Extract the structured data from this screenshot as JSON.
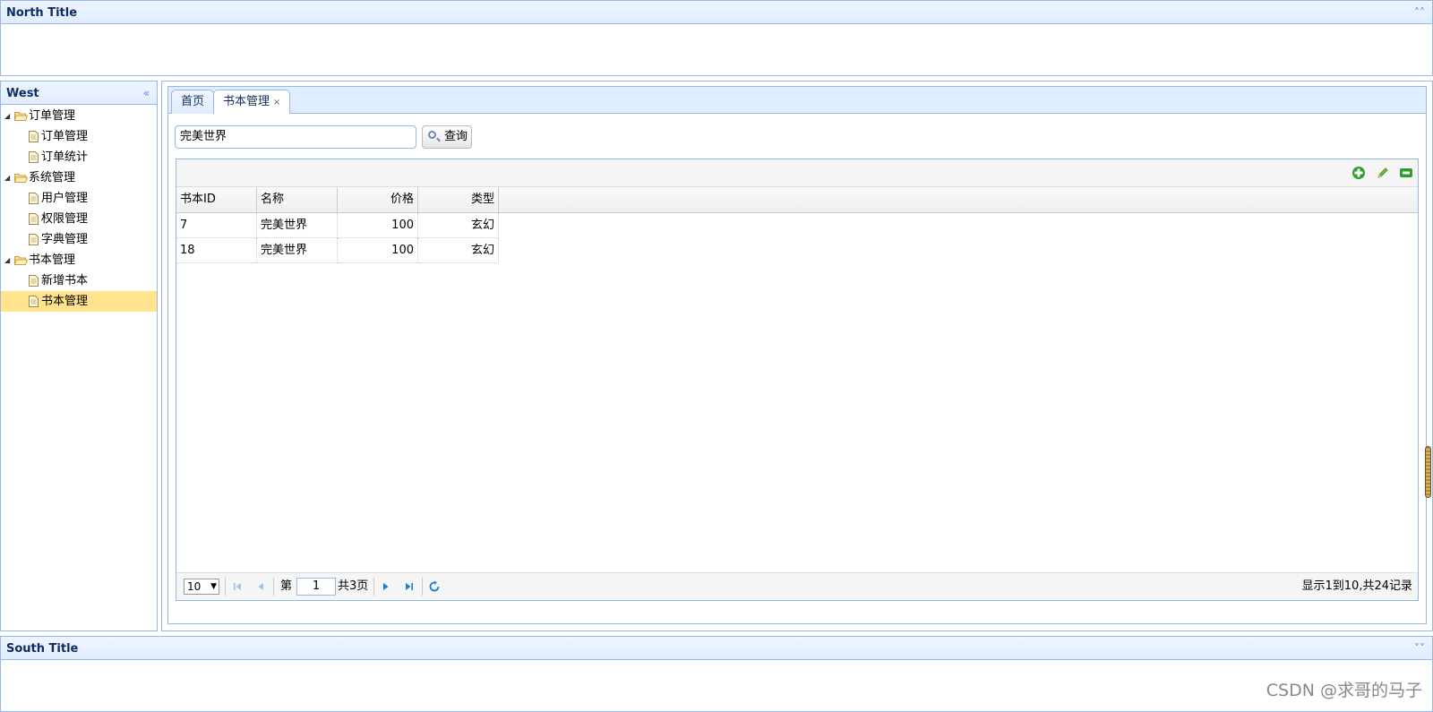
{
  "north": {
    "title": "North Title"
  },
  "west": {
    "title": "West"
  },
  "south": {
    "title": "South Title"
  },
  "tree": [
    {
      "label": "订单管理",
      "type": "folder"
    },
    {
      "label": "订单管理",
      "type": "file"
    },
    {
      "label": "订单统计",
      "type": "file"
    },
    {
      "label": "系统管理",
      "type": "folder"
    },
    {
      "label": "用户管理",
      "type": "file"
    },
    {
      "label": "权限管理",
      "type": "file"
    },
    {
      "label": "字典管理",
      "type": "file"
    },
    {
      "label": "书本管理",
      "type": "folder"
    },
    {
      "label": "新增书本",
      "type": "file"
    },
    {
      "label": "书本管理",
      "type": "file",
      "selected": true
    }
  ],
  "tabs": [
    {
      "label": "首页"
    },
    {
      "label": "书本管理",
      "close": "×",
      "active": true
    }
  ],
  "search": {
    "value": "完美世界",
    "button_label": "查询"
  },
  "toolbar": {
    "add_icon": "add-icon",
    "edit_icon": "edit-icon",
    "remove_icon": "remove-icon"
  },
  "grid": {
    "columns": [
      "书本ID",
      "名称",
      "价格",
      "类型"
    ],
    "rows": [
      [
        "7",
        "完美世界",
        "100",
        "玄幻"
      ],
      [
        "18",
        "完美世界",
        "100",
        "玄幻"
      ]
    ]
  },
  "pager": {
    "page_size": "10",
    "page_prefix": "第",
    "current_page": "1",
    "total_pages": "共3页",
    "info": "显示1到10,共24记录"
  },
  "watermark": "CSDN @求哥的马子",
  "colors": {
    "border": "#95b8e7",
    "header_bg": "#e0ecff",
    "selected": "#ffe48d",
    "icon_green": "#2e9d2e"
  }
}
